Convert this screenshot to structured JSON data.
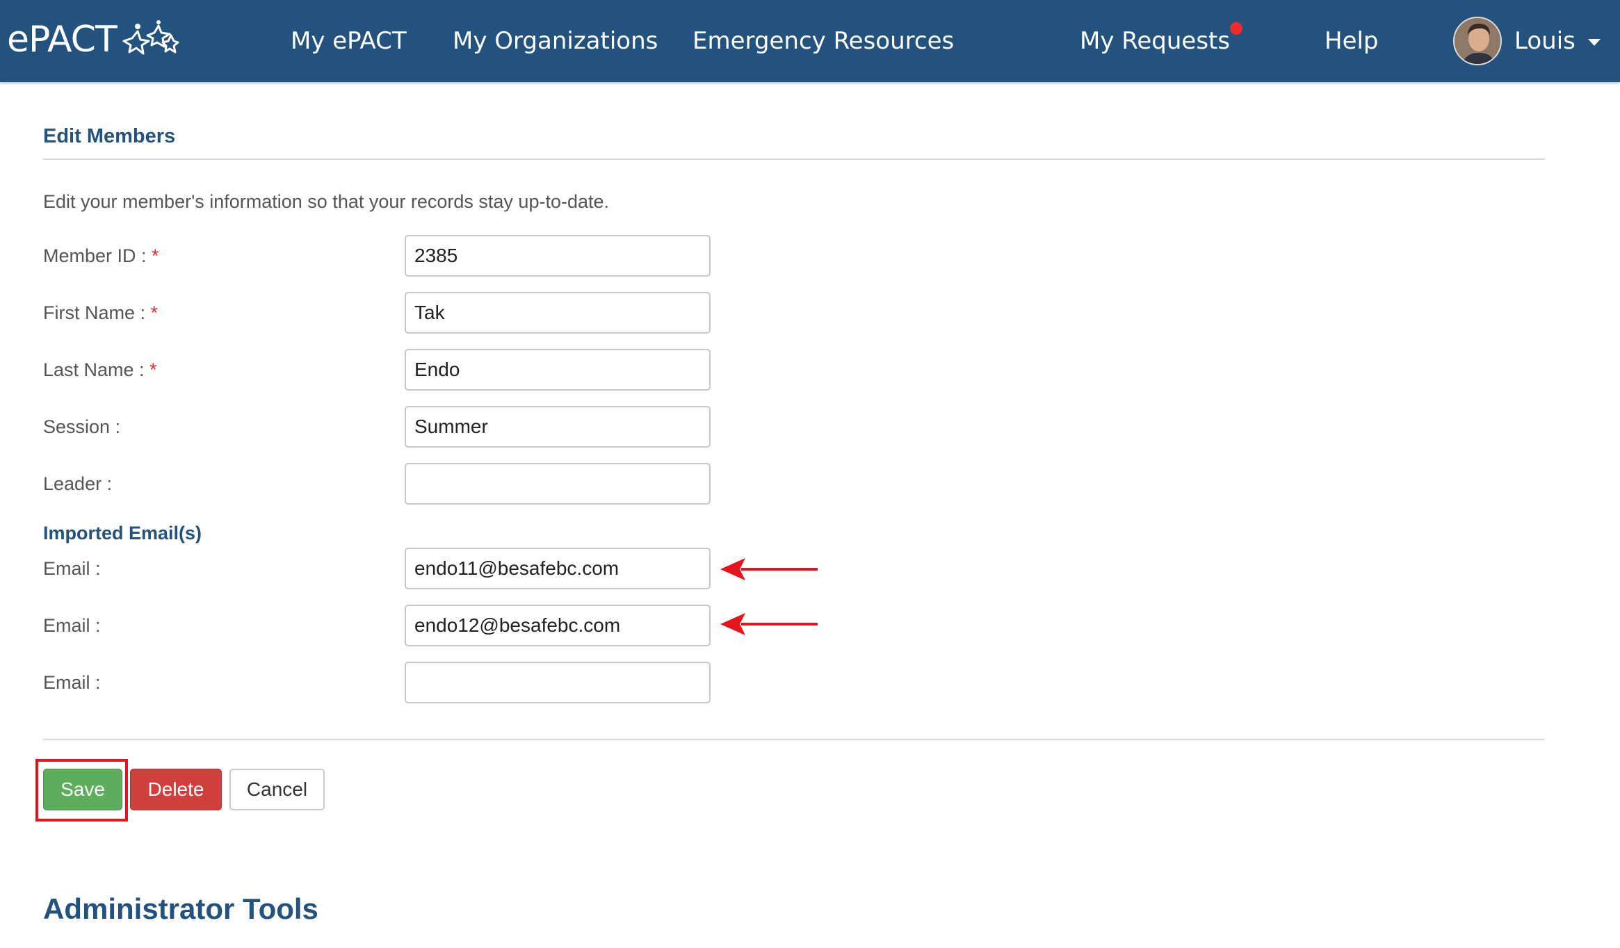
{
  "nav": {
    "brand": "ePACT",
    "items": [
      {
        "label": "My ePACT"
      },
      {
        "label": "My Organizations"
      },
      {
        "label": "Emergency Resources"
      },
      {
        "label": "My Requests"
      },
      {
        "label": "Help"
      }
    ],
    "user_name": "Louis",
    "notification_color": "#f02b2b",
    "brand_color": "#24527e"
  },
  "form": {
    "title": "Edit Members",
    "intro": "Edit your member's information so that your records stay up-to-date.",
    "required_marker": "*",
    "fields": [
      {
        "label": "Member ID :",
        "value": "2385",
        "required": true
      },
      {
        "label": "First Name :",
        "value": "Tak",
        "required": true
      },
      {
        "label": "Last Name :",
        "value": "Endo",
        "required": true
      },
      {
        "label": "Session :",
        "value": "Summer",
        "required": false
      },
      {
        "label": "Leader :",
        "value": "",
        "required": false
      }
    ],
    "emails_title": "Imported Email(s)",
    "emails": [
      {
        "label": "Email :",
        "value": "endo11@besafebc.com"
      },
      {
        "label": "Email :",
        "value": "endo12@besafebc.com"
      },
      {
        "label": "Email :",
        "value": ""
      }
    ]
  },
  "actions": {
    "save_label": "Save",
    "delete_label": "Delete",
    "cancel_label": "Cancel"
  },
  "admin": {
    "title": "Administrator Tools"
  },
  "annotation": {
    "arrow_color": "#e8141b",
    "highlight_color": "#e8141b"
  }
}
